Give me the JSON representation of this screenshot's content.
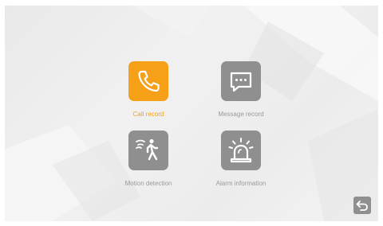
{
  "menu": {
    "items": [
      {
        "label": "Call record",
        "icon": "phone-icon",
        "selected": true
      },
      {
        "label": "Message record",
        "icon": "message-icon",
        "selected": false
      },
      {
        "label": "Motion detection",
        "icon": "motion-person-icon",
        "selected": false
      },
      {
        "label": "Alarm information",
        "icon": "alarm-siren-icon",
        "selected": false
      }
    ]
  },
  "back": {
    "icon": "back-arrow-icon"
  },
  "colors": {
    "accent": "#f5a016",
    "tile": "#8f8f8f",
    "label": "#9a9a9a",
    "background": "#ececec"
  }
}
